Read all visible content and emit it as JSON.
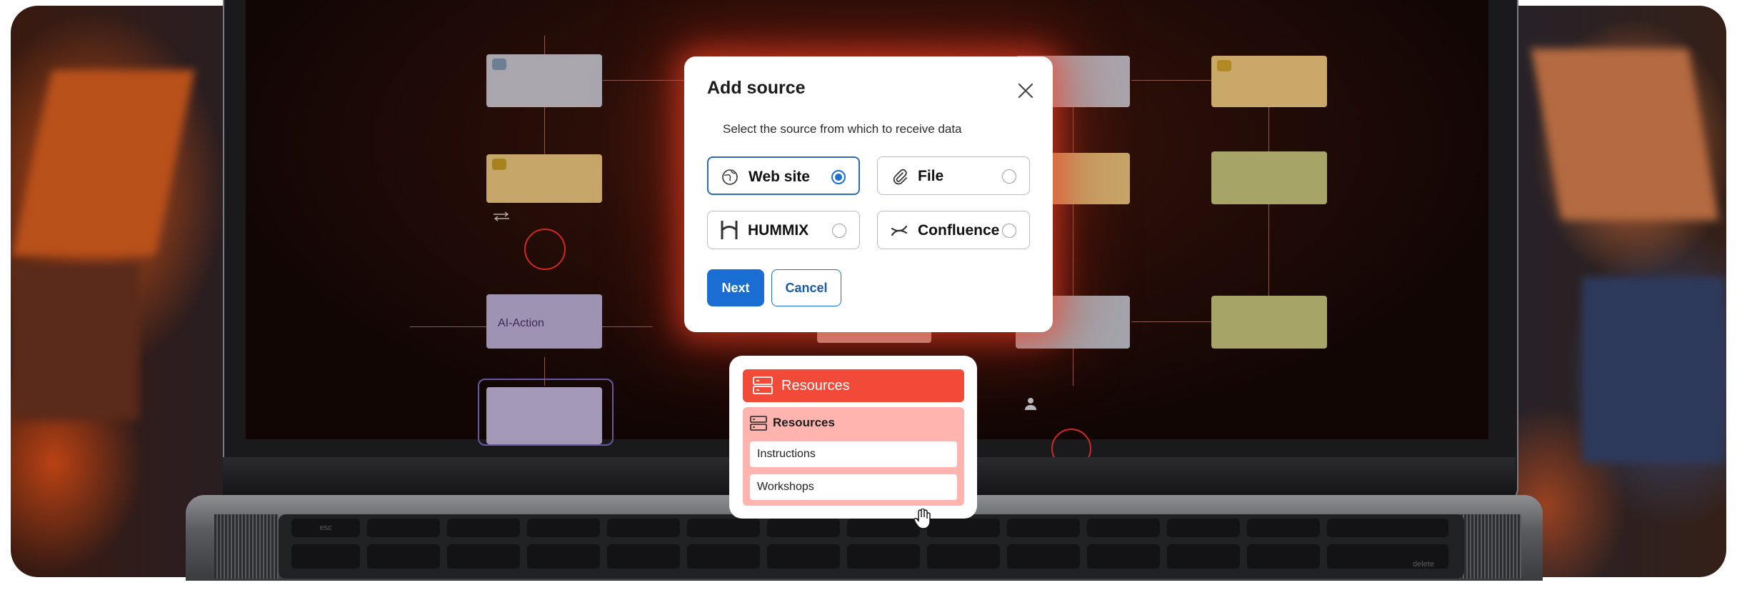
{
  "modal": {
    "title": "Add source",
    "subtitle": "Select the source from which to receive data",
    "options": [
      {
        "label": "Web site",
        "icon": "globe-icon",
        "selected": true
      },
      {
        "label": "File",
        "icon": "paperclip-icon",
        "selected": false
      },
      {
        "label": "HUMMIX",
        "icon": "hummix-logo-icon",
        "selected": false
      },
      {
        "label": "Confluence",
        "icon": "confluence-logo-icon",
        "selected": false
      }
    ],
    "next_label": "Next",
    "cancel_label": "Cancel",
    "accent_color": "#1a6dd2"
  },
  "workflow": {
    "ai_action_label": "AI-Action"
  },
  "resources_card": {
    "header_label": "Resources",
    "group_label": "Resources",
    "items": [
      "Instructions",
      "Workshops"
    ],
    "header_color": "#f24a38",
    "group_color": "#ffb4b0"
  },
  "keyboard": {
    "esc_label": "esc",
    "delete_label": "delete"
  }
}
